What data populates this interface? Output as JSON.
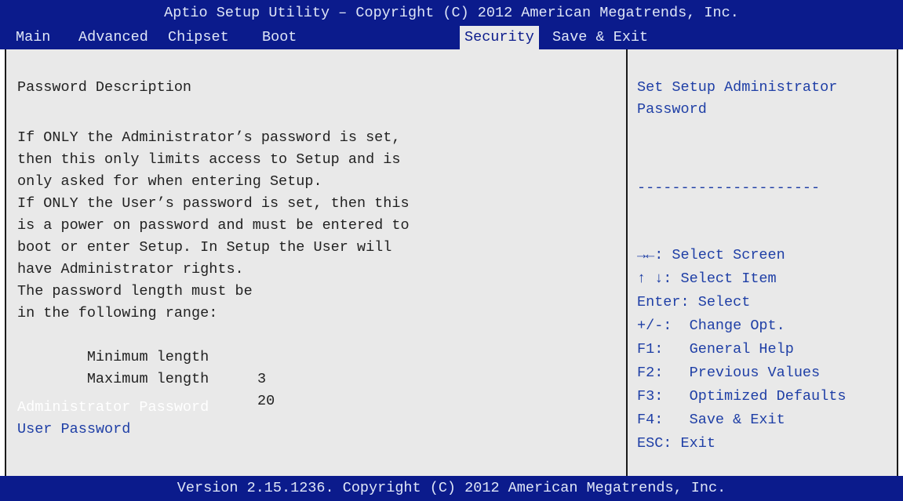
{
  "title": "Aptio Setup Utility – Copyright (C) 2012 American Megatrends, Inc.",
  "tabs": [
    {
      "label": "Main"
    },
    {
      "label": "Advanced"
    },
    {
      "label": "Chipset"
    },
    {
      "label": "Boot"
    },
    {
      "label": "Security",
      "active": true
    },
    {
      "label": "Save & Exit"
    }
  ],
  "main": {
    "heading": "Password Description",
    "description": [
      "If ONLY the Administrator’s password is set,",
      "then this only limits access to Setup and is",
      "only asked for when entering Setup.",
      "If ONLY the User’s password is set, then this",
      "is a power on password and must be entered to",
      "boot or enter Setup. In Setup the User will",
      "have Administrator rights.",
      "The password length must be",
      "in the following range:"
    ],
    "min_label": "Minimum length",
    "min_value": "3",
    "max_label": "Maximum length",
    "max_value": "20",
    "admin_password": "Administrator Password",
    "user_password": "User Password"
  },
  "help": {
    "line1": "Set Setup Administrator",
    "line2": "Password",
    "separator": "---------------------",
    "keys": [
      "→←: Select Screen",
      "↑ ↓: Select Item",
      "Enter: Select",
      "+/-:  Change Opt.",
      "F1:   General Help",
      "F2:   Previous Values",
      "F3:   Optimized Defaults",
      "F4:   Save & Exit",
      "ESC: Exit"
    ]
  },
  "footer": "Version 2.15.1236. Copyright (C) 2012 American Megatrends, Inc.",
  "colors": {
    "bar_bg": "#0b1b8c",
    "panel_bg": "#e9e9e9",
    "highlight_text": "#1f3fa6",
    "selected_item": "#ffffff"
  }
}
